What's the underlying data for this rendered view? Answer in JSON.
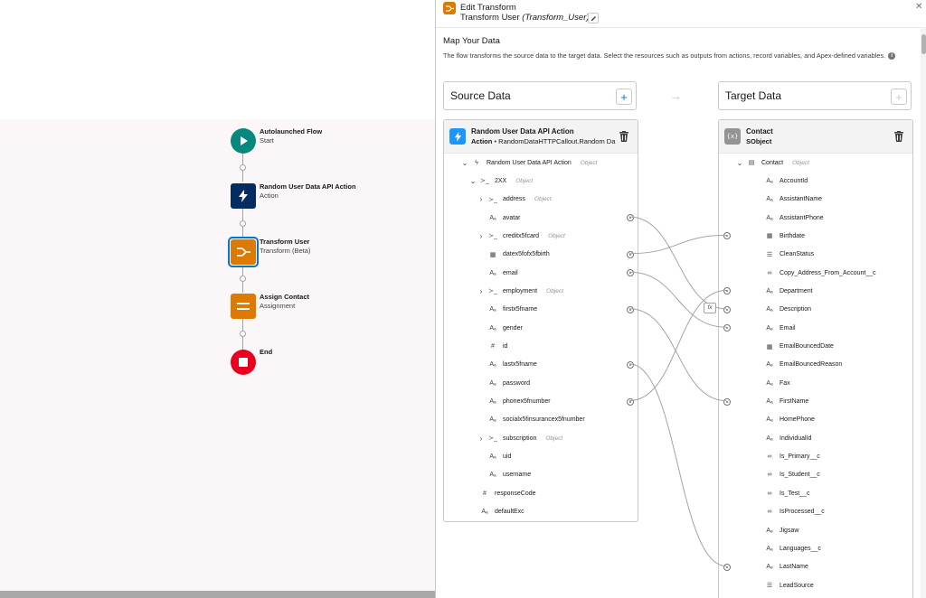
{
  "flow": {
    "nodes": [
      {
        "title": "Autolaunched Flow",
        "subtitle": "Start",
        "icon": "play-icon",
        "color": "#06887f"
      },
      {
        "title": "Random User Data API Action",
        "subtitle": "Action",
        "icon": "lightning-icon",
        "color": "#032d60"
      },
      {
        "title": "Transform User",
        "subtitle": "Transform (Beta)",
        "icon": "transform-icon",
        "color": "#dd7a01"
      },
      {
        "title": "Assign Contact",
        "subtitle": "Assignment",
        "icon": "assignment-icon",
        "color": "#dd7a01"
      },
      {
        "title": "End",
        "subtitle": "",
        "icon": "stop-icon",
        "color": "#ea001e"
      }
    ]
  },
  "panel": {
    "title": "Edit Transform",
    "subtitle_label": "Transform User",
    "subtitle_api": "(Transform_User)",
    "map_title": "Map Your Data",
    "map_desc": "The flow transforms the source data to the target data. Select the resources such as outputs from actions, record variables, and Apex-defined variables.",
    "source_header": "Source Data",
    "target_header": "Target Data"
  },
  "source_card": {
    "title": "Random User Data API Action",
    "type_label": "Action",
    "type_detail": "RandomDataHTTPCallout.Random Da",
    "rows": [
      {
        "chev": "⌄",
        "icon": "lightning-icon",
        "glyph": "ϟ",
        "name": "Random User Data API Action",
        "type": "Object",
        "indent": 0
      },
      {
        "chev": "⌄",
        "icon": "apex-icon",
        "glyph": "≻_",
        "name": "2XX",
        "type": "Object",
        "indent": 1
      },
      {
        "chev": "›",
        "icon": "apex-icon",
        "glyph": "≻_",
        "name": "address",
        "type": "Object",
        "indent": 2
      },
      {
        "chev": "",
        "icon": "text-icon",
        "glyph": "Aₐ",
        "name": "avatar",
        "type": "",
        "indent": 2,
        "port": true
      },
      {
        "chev": "›",
        "icon": "apex-icon",
        "glyph": "≻_",
        "name": "creditx5fcard",
        "type": "Object",
        "indent": 2
      },
      {
        "chev": "",
        "icon": "date-icon",
        "glyph": "▦",
        "name": "datex5fofx5fbirth",
        "type": "",
        "indent": 2,
        "port": true
      },
      {
        "chev": "",
        "icon": "text-icon",
        "glyph": "Aₐ",
        "name": "email",
        "type": "",
        "indent": 2,
        "port": true
      },
      {
        "chev": "›",
        "icon": "apex-icon",
        "glyph": "≻_",
        "name": "employment",
        "type": "Object",
        "indent": 2
      },
      {
        "chev": "",
        "icon": "text-icon",
        "glyph": "Aₐ",
        "name": "firstx5fname",
        "type": "",
        "indent": 2,
        "port": true
      },
      {
        "chev": "",
        "icon": "text-icon",
        "glyph": "Aₐ",
        "name": "gender",
        "type": "",
        "indent": 2
      },
      {
        "chev": "",
        "icon": "number-icon",
        "glyph": "#",
        "name": "id",
        "type": "",
        "indent": 2
      },
      {
        "chev": "",
        "icon": "text-icon",
        "glyph": "Aₐ",
        "name": "lastx5fname",
        "type": "",
        "indent": 2,
        "port": true
      },
      {
        "chev": "",
        "icon": "text-icon",
        "glyph": "Aₐ",
        "name": "password",
        "type": "",
        "indent": 2
      },
      {
        "chev": "",
        "icon": "text-icon",
        "glyph": "Aₐ",
        "name": "phonex5fnumber",
        "type": "",
        "indent": 2,
        "port": true
      },
      {
        "chev": "",
        "icon": "text-icon",
        "glyph": "Aₐ",
        "name": "socialx5finsurancex5fnumber",
        "type": "",
        "indent": 2
      },
      {
        "chev": "›",
        "icon": "apex-icon",
        "glyph": "≻_",
        "name": "subscription",
        "type": "Object",
        "indent": 2
      },
      {
        "chev": "",
        "icon": "text-icon",
        "glyph": "Aₐ",
        "name": "uid",
        "type": "",
        "indent": 2
      },
      {
        "chev": "",
        "icon": "text-icon",
        "glyph": "Aₐ",
        "name": "username",
        "type": "",
        "indent": 2
      },
      {
        "chev": "",
        "icon": "number-icon",
        "glyph": "#",
        "name": "responseCode",
        "type": "",
        "indent": 1
      },
      {
        "chev": "",
        "icon": "text-icon",
        "glyph": "Aₐ",
        "name": "defaultExc",
        "type": "",
        "indent": 1
      }
    ]
  },
  "target_card": {
    "title": "Contact",
    "type_label": "SObject",
    "rows": [
      {
        "chev": "⌄",
        "icon": "record-icon",
        "glyph": "▤",
        "name": "Contact",
        "type": "Object",
        "indent": 0
      },
      {
        "chev": "",
        "icon": "text-icon",
        "glyph": "Aₐ",
        "name": "AccountId",
        "type": "",
        "indent": 1
      },
      {
        "chev": "",
        "icon": "text-icon",
        "glyph": "Aₐ",
        "name": "AssistantName",
        "type": "",
        "indent": 1
      },
      {
        "chev": "",
        "icon": "text-icon",
        "glyph": "Aₐ",
        "name": "AssistantPhone",
        "type": "",
        "indent": 1
      },
      {
        "chev": "",
        "icon": "date-icon",
        "glyph": "▦",
        "name": "Birthdate",
        "type": "",
        "indent": 1,
        "port": true
      },
      {
        "chev": "",
        "icon": "picklist-icon",
        "glyph": "☰",
        "name": "CleanStatus",
        "type": "",
        "indent": 1
      },
      {
        "chev": "",
        "icon": "formula-icon",
        "glyph": "∞",
        "name": "Copy_Address_From_Account__c",
        "type": "",
        "indent": 1
      },
      {
        "chev": "",
        "icon": "text-icon",
        "glyph": "Aₐ",
        "name": "Department",
        "type": "",
        "indent": 1,
        "port": true
      },
      {
        "chev": "",
        "icon": "text-icon",
        "glyph": "Aₐ",
        "name": "Description",
        "type": "",
        "indent": 1,
        "port": true
      },
      {
        "chev": "",
        "icon": "text-icon",
        "glyph": "Aₐ",
        "name": "Email",
        "type": "",
        "indent": 1,
        "port": true
      },
      {
        "chev": "",
        "icon": "date-icon",
        "glyph": "▦",
        "name": "EmailBouncedDate",
        "type": "",
        "indent": 1
      },
      {
        "chev": "",
        "icon": "text-icon",
        "glyph": "Aₐ",
        "name": "EmailBouncedReason",
        "type": "",
        "indent": 1
      },
      {
        "chev": "",
        "icon": "text-icon",
        "glyph": "Aₐ",
        "name": "Fax",
        "type": "",
        "indent": 1
      },
      {
        "chev": "",
        "icon": "text-icon",
        "glyph": "Aₐ",
        "name": "FirstName",
        "type": "",
        "indent": 1,
        "port": true
      },
      {
        "chev": "",
        "icon": "text-icon",
        "glyph": "Aₐ",
        "name": "HomePhone",
        "type": "",
        "indent": 1
      },
      {
        "chev": "",
        "icon": "text-icon",
        "glyph": "Aₐ",
        "name": "IndividualId",
        "type": "",
        "indent": 1
      },
      {
        "chev": "",
        "icon": "formula-icon",
        "glyph": "∞",
        "name": "Is_Primary__c",
        "type": "",
        "indent": 1
      },
      {
        "chev": "",
        "icon": "formula-icon",
        "glyph": "∞",
        "name": "Is_Student__c",
        "type": "",
        "indent": 1
      },
      {
        "chev": "",
        "icon": "formula-icon",
        "glyph": "∞",
        "name": "Is_Test__c",
        "type": "",
        "indent": 1
      },
      {
        "chev": "",
        "icon": "formula-icon",
        "glyph": "∞",
        "name": "IsProcessed__c",
        "type": "",
        "indent": 1
      },
      {
        "chev": "",
        "icon": "text-icon",
        "glyph": "Aₐ",
        "name": "Jigsaw",
        "type": "",
        "indent": 1
      },
      {
        "chev": "",
        "icon": "text-icon",
        "glyph": "Aₐ",
        "name": "Languages__c",
        "type": "",
        "indent": 1
      },
      {
        "chev": "",
        "icon": "text-icon",
        "glyph": "Aₐ",
        "name": "LastName",
        "type": "",
        "indent": 1,
        "port": true
      },
      {
        "chev": "",
        "icon": "picklist-icon",
        "glyph": "☰",
        "name": "LeadSource",
        "type": "",
        "indent": 1
      }
    ]
  },
  "mappings": [
    {
      "from": "avatar",
      "to": "Description"
    },
    {
      "from": "datex5fofx5fbirth",
      "to": "Birthdate"
    },
    {
      "from": "email",
      "to": "Email"
    },
    {
      "from": "firstx5fname",
      "to": "FirstName"
    },
    {
      "from": "lastx5fname",
      "to": "LastName"
    },
    {
      "from": "phonex5fnumber",
      "to": "Department"
    }
  ],
  "colors": {
    "accent": "#0176d3",
    "action": "#032d60",
    "transform": "#dd7a01",
    "start": "#06887f",
    "end": "#ea001e"
  }
}
